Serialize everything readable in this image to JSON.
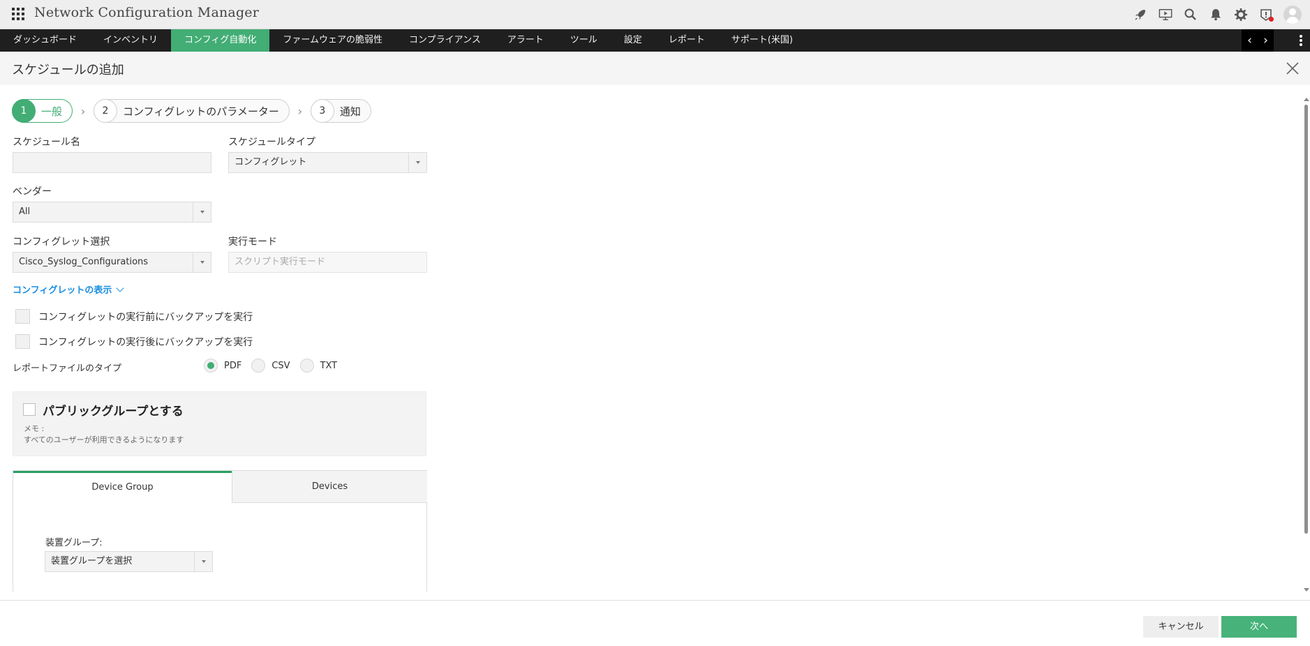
{
  "app": {
    "title": "Network Configuration Manager"
  },
  "nav": {
    "items": [
      {
        "label": "ダッシュボード",
        "active": false
      },
      {
        "label": "インベントリ",
        "active": false
      },
      {
        "label": "コンフィグ自動化",
        "active": true
      },
      {
        "label": "ファームウェアの脆弱性",
        "active": false
      },
      {
        "label": "コンプライアンス",
        "active": false
      },
      {
        "label": "アラート",
        "active": false
      },
      {
        "label": "ツール",
        "active": false
      },
      {
        "label": "設定",
        "active": false
      },
      {
        "label": "レポート",
        "active": false
      },
      {
        "label": "サポート(米国)",
        "active": false
      }
    ],
    "prev_arrow": "‹",
    "next_arrow": "›"
  },
  "header_icons": [
    "rocket-icon",
    "presentation-icon",
    "search-icon",
    "bell-icon",
    "gear-icon",
    "alert-shield-icon",
    "avatar"
  ],
  "page": {
    "title": "スケジュールの追加"
  },
  "steps": [
    {
      "num": "1",
      "label": "一般",
      "active": true
    },
    {
      "num": "2",
      "label": "コンフィグレットのパラメーター",
      "active": false
    },
    {
      "num": "3",
      "label": "通知",
      "active": false
    }
  ],
  "form": {
    "schedule_name": {
      "label": "スケジュール名",
      "value": ""
    },
    "schedule_type": {
      "label": "スケジュールタイプ",
      "value": "コンフィグレット"
    },
    "vendor": {
      "label": "ベンダー",
      "value": "All"
    },
    "configlet_select": {
      "label": "コンフィグレット選択",
      "value": "Cisco_Syslog_Configurations"
    },
    "exec_mode": {
      "label": "実行モード",
      "placeholder": "スクリプト実行モード"
    },
    "show_configlet_link": "コンフィグレットの表示",
    "backup_before": {
      "label": "コンフィグレットの実行前にバックアップを実行",
      "checked": false
    },
    "backup_after": {
      "label": "コンフィグレットの実行後にバックアップを実行",
      "checked": false
    },
    "report_type": {
      "label": "レポートファイルのタイプ",
      "options": [
        "PDF",
        "CSV",
        "TXT"
      ],
      "selected": "PDF"
    },
    "public_group": {
      "title": "パブリックグループとする",
      "memo_label": "メモ :",
      "memo_text": "すべてのユーザーが利用できるようになります",
      "checked": false
    },
    "tabs": [
      {
        "label": "Device Group",
        "active": true
      },
      {
        "label": "Devices",
        "active": false
      }
    ],
    "device_group": {
      "label": "装置グループ:",
      "value": "装置グループを選択"
    }
  },
  "footer": {
    "cancel_label": "キャンセル",
    "next_label": "次へ"
  },
  "colors": {
    "accent": "#42ad75",
    "nav_bg": "#1f1f1f",
    "link": "#1a8fe3"
  }
}
